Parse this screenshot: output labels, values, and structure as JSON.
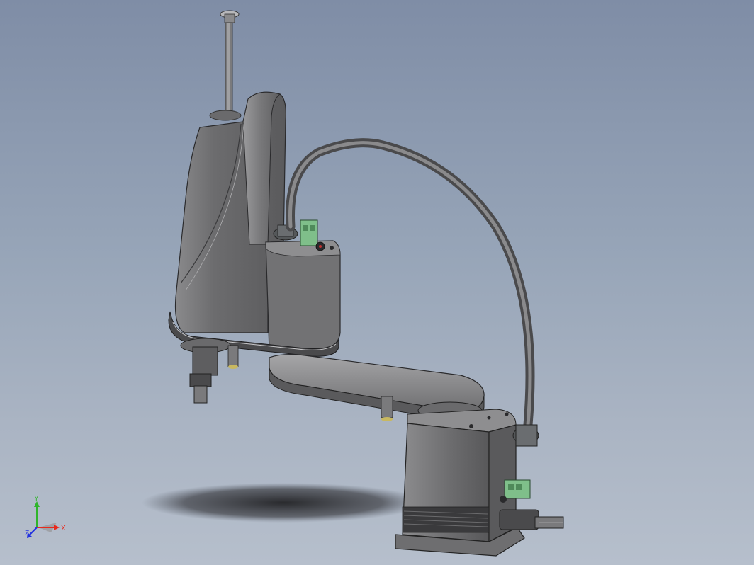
{
  "viewport": {
    "background_top": "#7f8da6",
    "background_bottom": "#b6bfcc"
  },
  "model": {
    "body_color": "#6e6e70",
    "body_highlight": "#a9a9ab",
    "body_shadow": "#4a4a4c",
    "connector_color": "#7fbf8a",
    "shadow_color": "#1a1a1c"
  },
  "triad": {
    "x_label": "X",
    "y_label": "Y",
    "z_label": "Z",
    "x_color": "#e8291c",
    "y_color": "#2fb52a",
    "z_color": "#2130e0"
  }
}
